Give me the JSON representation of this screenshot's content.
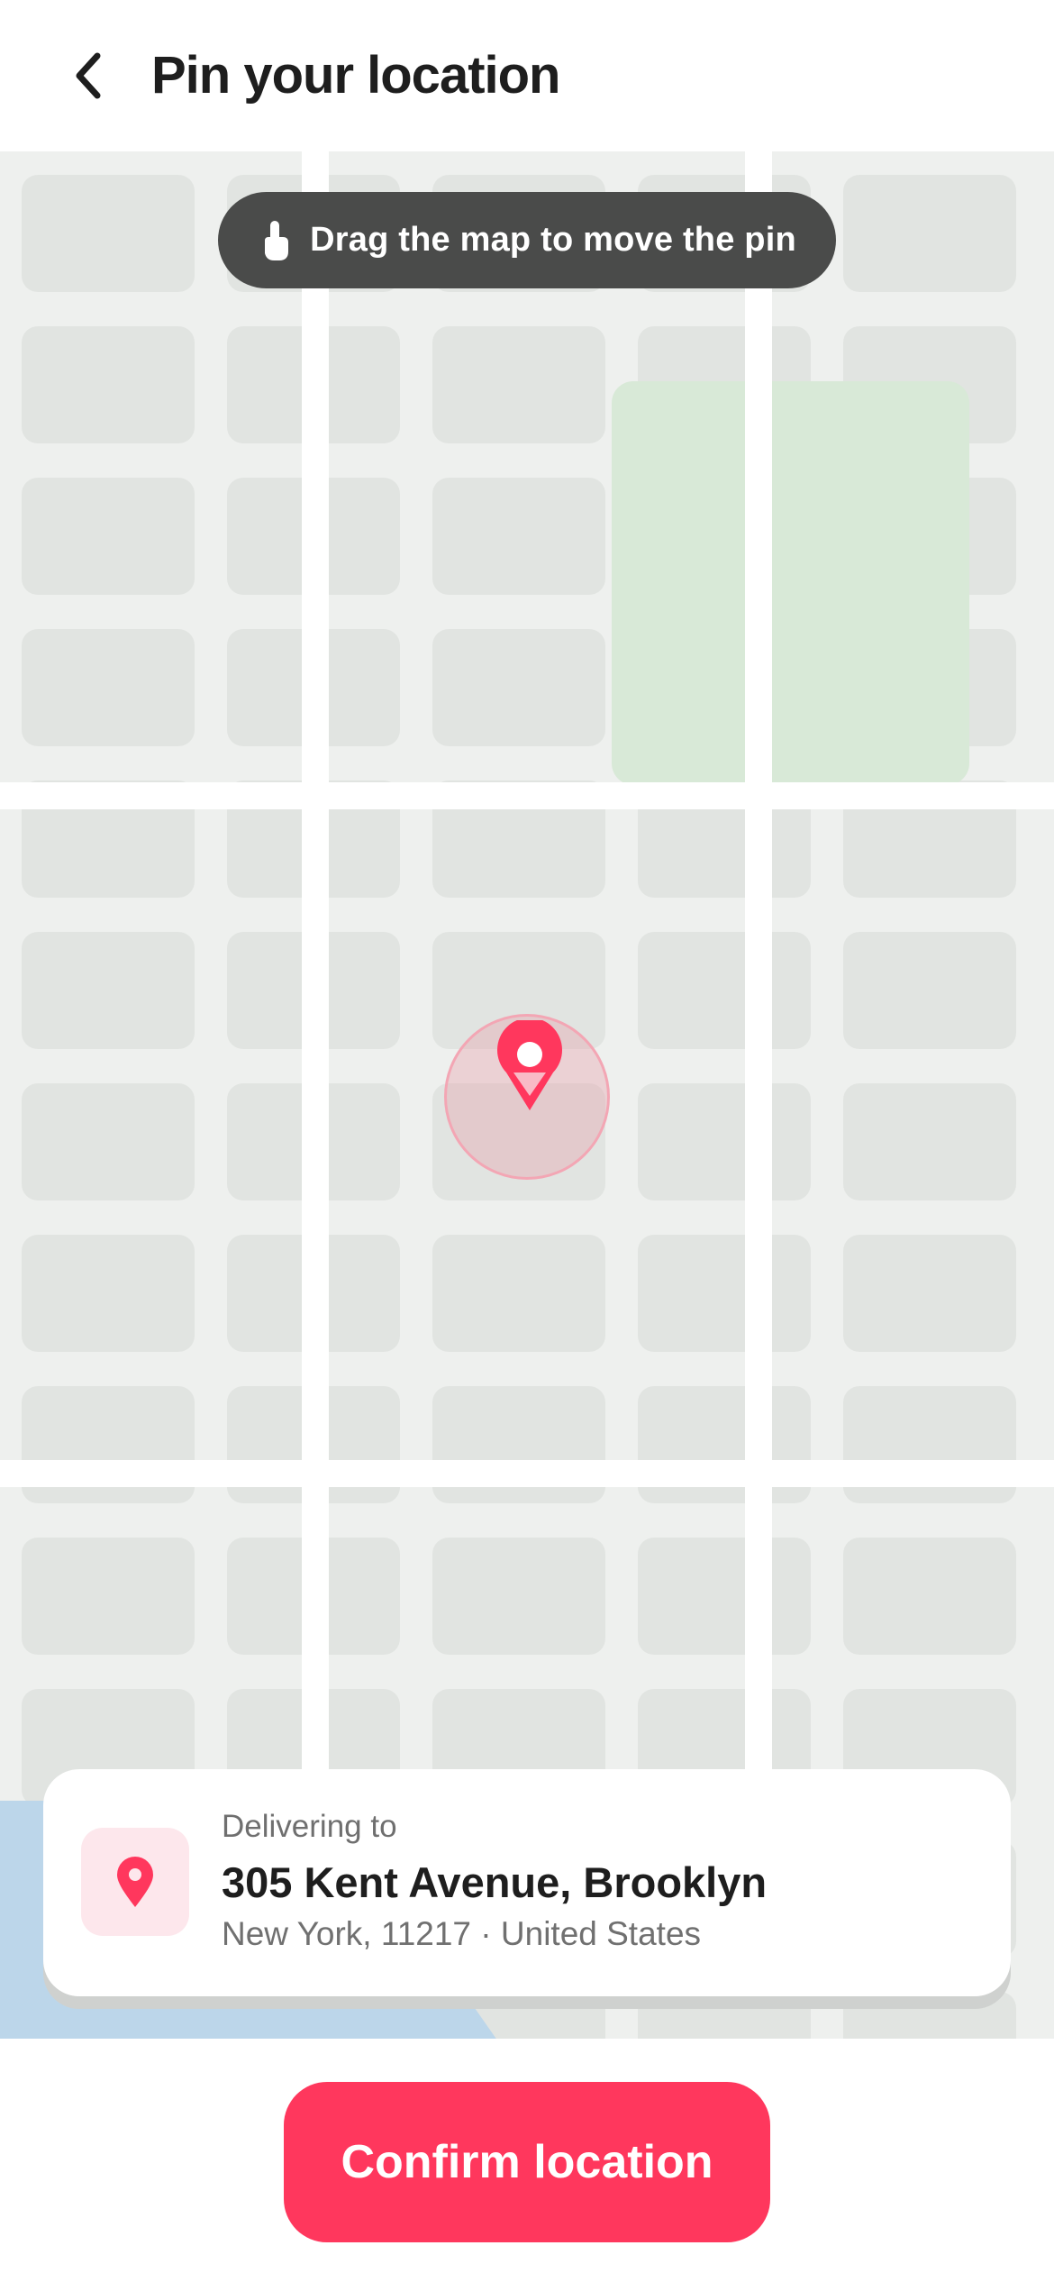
{
  "header": {
    "back_icon": "chevron-left-icon",
    "title": "Pin your location"
  },
  "map": {
    "hint": {
      "icon": "hand-pointer-icon",
      "text": "Drag the map to move the pin"
    },
    "pin_icon": "location-pin-icon",
    "colors": {
      "background": "#eef0ee",
      "block": "#e1e4e1",
      "park": "#d8e9d7",
      "water": "#bcd6ea"
    }
  },
  "address_card": {
    "icon": "map-pin-icon",
    "label": "Delivering to",
    "line1": "305 Kent Avenue, Brooklyn",
    "line2": "New York, 11217 · United States"
  },
  "actions": {
    "confirm_label": "Confirm location"
  },
  "colors": {
    "accent": "#ff375d",
    "accent_soft": "#fde7ec",
    "hint_pill": "#4a4b4a"
  }
}
